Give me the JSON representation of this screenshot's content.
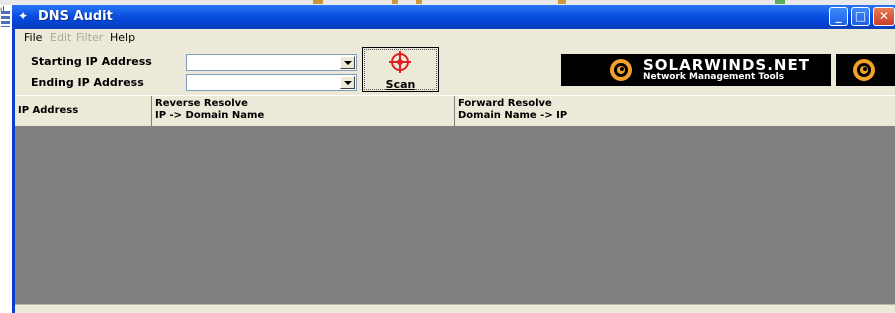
{
  "window": {
    "title": "DNS Audit"
  },
  "desktop": {
    "left_text": "ıL"
  },
  "menu": [
    {
      "label": "File",
      "enabled": true
    },
    {
      "label": "Edit",
      "enabled": false
    },
    {
      "label": "Filter",
      "enabled": false
    },
    {
      "label": "Help",
      "enabled": true
    }
  ],
  "toolbar": {
    "start_label": "Starting IP Address",
    "start_value": "",
    "end_label": "Ending IP Address",
    "end_value": "",
    "scan_label": "Scan",
    "logo_brand": "SOLARWINDS.NET",
    "logo_tagline": "Network Management Tools"
  },
  "grid": {
    "columns": [
      {
        "line1": "IP Address",
        "line2": ""
      },
      {
        "line1": "Reverse Resolve",
        "line2": "IP -> Domain Name"
      },
      {
        "line1": "Forward Resolve",
        "line2": "Domain Name -> IP"
      }
    ],
    "rows": []
  },
  "colors": {
    "titlebar": "#0a4fe0",
    "grid_background": "#808080",
    "logo_background": "#000000",
    "scan_target": "#e02020"
  }
}
